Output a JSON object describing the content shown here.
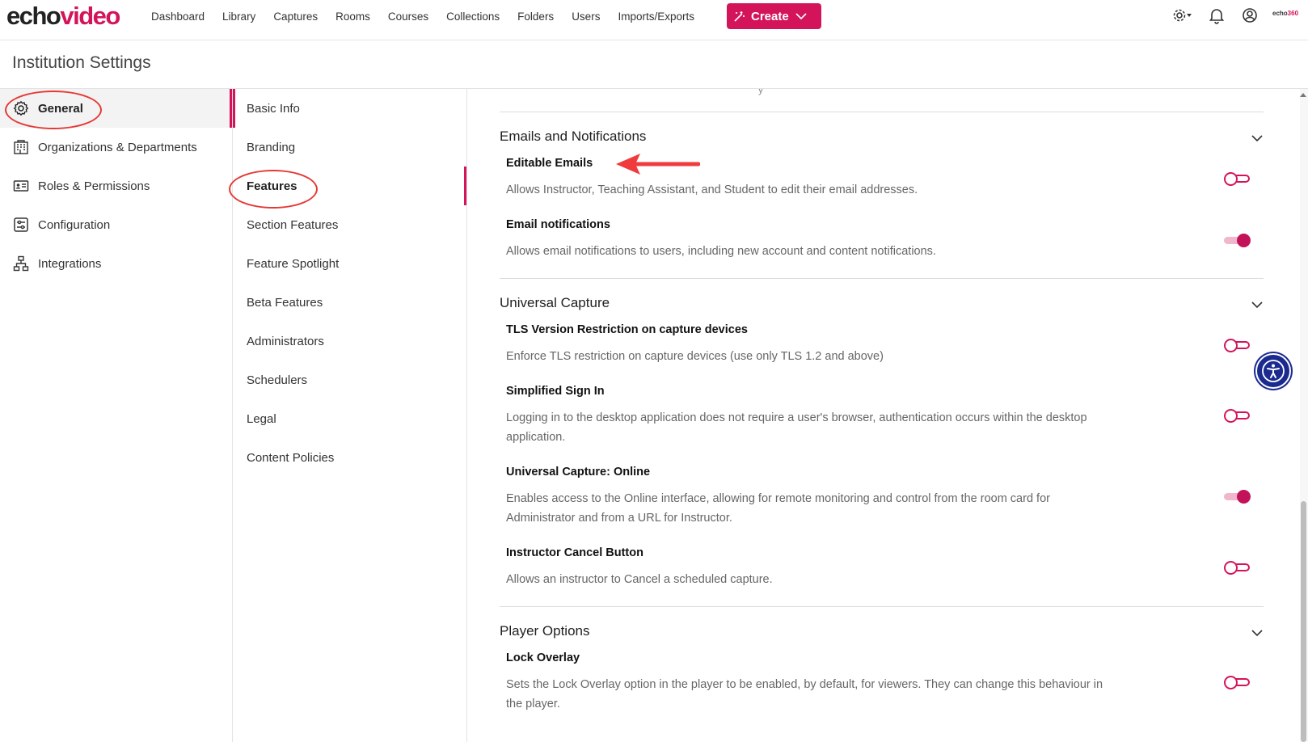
{
  "app": {
    "logo_part1": "echo",
    "logo_part2": "video",
    "mini_logo_part1": "echo",
    "mini_logo_part2": "360",
    "brand_color": "#d4145a"
  },
  "nav": {
    "links": [
      "Dashboard",
      "Library",
      "Captures",
      "Rooms",
      "Courses",
      "Collections",
      "Folders",
      "Users",
      "Imports/Exports"
    ],
    "create_label": "Create",
    "right_icons": [
      "settings-gear-icon",
      "notifications-bell-icon",
      "user-account-icon"
    ]
  },
  "page": {
    "title": "Institution Settings"
  },
  "sidebar": {
    "items": [
      {
        "label": "General",
        "icon": "gear-icon",
        "active": true
      },
      {
        "label": "Organizations & Departments",
        "icon": "building-icon",
        "active": false
      },
      {
        "label": "Roles & Permissions",
        "icon": "id-card-icon",
        "active": false
      },
      {
        "label": "Configuration",
        "icon": "sliders-icon",
        "active": false
      },
      {
        "label": "Integrations",
        "icon": "network-icon",
        "active": false
      }
    ]
  },
  "midnav": {
    "items": [
      {
        "label": "Basic Info",
        "active": false
      },
      {
        "label": "Branding",
        "active": false
      },
      {
        "label": "Features",
        "active": true
      },
      {
        "label": "Section Features",
        "active": false
      },
      {
        "label": "Feature Spotlight",
        "active": false
      },
      {
        "label": "Beta Features",
        "active": false
      },
      {
        "label": "Administrators",
        "active": false
      },
      {
        "label": "Schedulers",
        "active": false
      },
      {
        "label": "Legal",
        "active": false
      },
      {
        "label": "Content Policies",
        "active": false
      }
    ]
  },
  "content": {
    "partial_top_text": "y",
    "sections": [
      {
        "title": "Emails and Notifications",
        "settings": [
          {
            "title": "Editable Emails",
            "description": "Allows Instructor, Teaching Assistant, and Student to edit their email addresses.",
            "enabled": false
          },
          {
            "title": "Email notifications",
            "description": "Allows email notifications to users, including new account and content notifications.",
            "enabled": true
          }
        ]
      },
      {
        "title": "Universal Capture",
        "settings": [
          {
            "title": "TLS Version Restriction on capture devices",
            "description": "Enforce TLS restriction on capture devices (use only TLS 1.2 and above)",
            "enabled": false
          },
          {
            "title": "Simplified Sign In",
            "description": "Logging in to the desktop application does not require a user's browser, authentication occurs within the desktop application.",
            "enabled": false
          },
          {
            "title": "Universal Capture: Online",
            "description": "Enables access to the Online interface, allowing for remote monitoring and control from the room card for Administrator and from a URL for Instructor.",
            "enabled": true
          },
          {
            "title": "Instructor Cancel Button",
            "description": "Allows an instructor to Cancel a scheduled capture.",
            "enabled": false
          }
        ]
      },
      {
        "title": "Player Options",
        "settings": [
          {
            "title": "Lock Overlay",
            "description": "Sets the Lock Overlay option in the player to be enabled, by default, for viewers. They can change this behaviour in the player.",
            "enabled": false
          }
        ]
      }
    ]
  },
  "annotations": {
    "color": "#e53935",
    "circled": [
      "General",
      "Features"
    ],
    "arrow_points_to": "Editable Emails"
  }
}
